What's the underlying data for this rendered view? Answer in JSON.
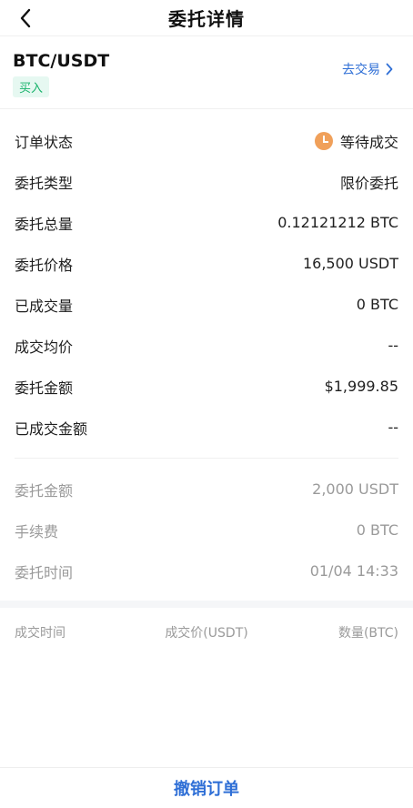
{
  "header": {
    "title": "委托详情",
    "back_icon": "chevron-left-icon"
  },
  "pair": {
    "name": "BTC/USDT",
    "side": "买入",
    "trade_link": "去交易",
    "side_color": "#17b26a",
    "link_color": "#2f6fd6"
  },
  "details": [
    {
      "label": "订单状态",
      "value": "等待成交",
      "icon": "clock-icon"
    },
    {
      "label": "委托类型",
      "value": "限价委托"
    },
    {
      "label": "委托总量",
      "value": "0.12121212 BTC"
    },
    {
      "label": "委托价格",
      "value": "16,500 USDT"
    },
    {
      "label": "已成交量",
      "value": "0 BTC"
    },
    {
      "label": "成交均价",
      "value": "--"
    },
    {
      "label": "委托金额",
      "value": "$1,999.85"
    },
    {
      "label": "已成交金额",
      "value": "--"
    }
  ],
  "secondary": [
    {
      "label": "委托金额",
      "value": "2,000 USDT"
    },
    {
      "label": "手续费",
      "value": "0 BTC"
    },
    {
      "label": "委托时间",
      "value": "01/04 14:33"
    }
  ],
  "trades": {
    "columns": [
      "成交时间",
      "成交价(USDT)",
      "数量(BTC)"
    ]
  },
  "footer": {
    "cancel_label": "撤销订单"
  }
}
